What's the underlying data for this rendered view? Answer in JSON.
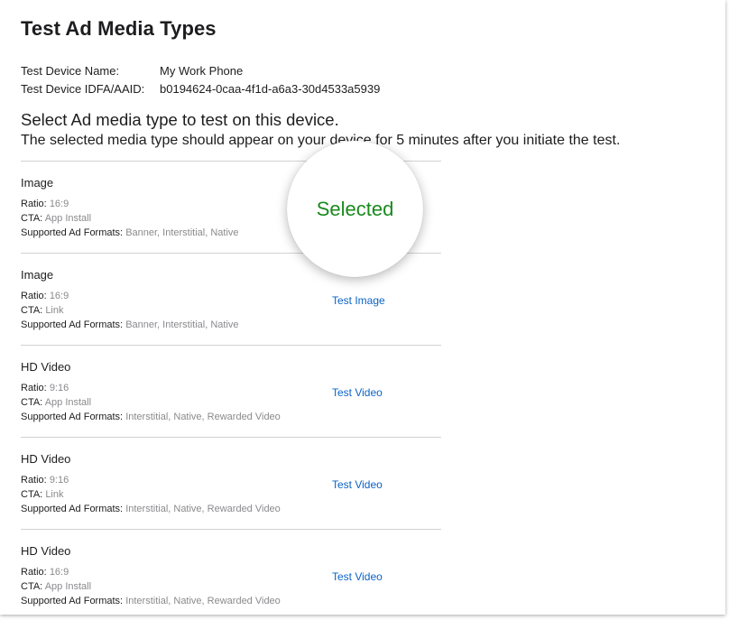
{
  "page": {
    "title": "Test Ad Media Types"
  },
  "device": {
    "name_label": "Test Device Name:",
    "name_value": "My Work Phone",
    "id_label": "Test Device IDFA/AAID:",
    "id_value": "b0194624-0caa-4f1d-a6a3-30d4533a5939"
  },
  "instructions": {
    "heading": "Select Ad media type to test on this device.",
    "subtext": "The selected media type should appear on your device for 5 minutes after you initiate the test."
  },
  "labels": {
    "ratio": "Ratio:",
    "cta": "CTA:",
    "formats": "Supported Ad Formats:"
  },
  "selected_badge": "Selected",
  "colors": {
    "selected_green": "#1a8a1e",
    "link_blue": "#0b63c5"
  },
  "media_items": [
    {
      "name": "Image",
      "ratio": "16:9",
      "cta": "App Install",
      "formats": "Banner, Interstitial, Native",
      "action": ""
    },
    {
      "name": "Image",
      "ratio": "16:9",
      "cta": "Link",
      "formats": "Banner, Interstitial, Native",
      "action": "Test Image"
    },
    {
      "name": "HD Video",
      "ratio": "9:16",
      "cta": "App Install",
      "formats": "Interstitial, Native, Rewarded Video",
      "action": "Test Video"
    },
    {
      "name": "HD Video",
      "ratio": "9:16",
      "cta": "Link",
      "formats": "Interstitial, Native, Rewarded Video",
      "action": "Test Video"
    },
    {
      "name": "HD Video",
      "ratio": "16:9",
      "cta": "App Install",
      "formats": "Interstitial, Native, Rewarded Video",
      "action": "Test Video"
    }
  ]
}
